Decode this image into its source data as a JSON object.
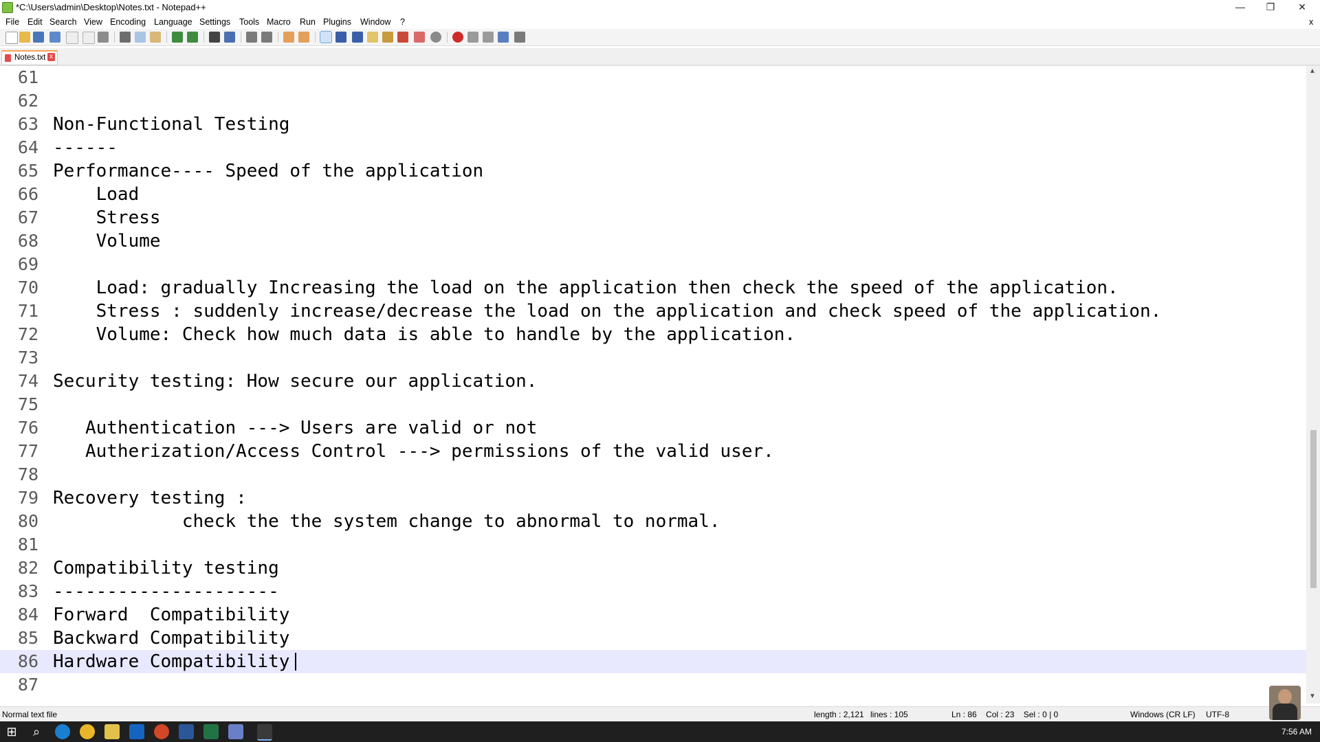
{
  "window": {
    "title": "*C:\\Users\\admin\\Desktop\\Notes.txt - Notepad++",
    "minimize_glyph": "—",
    "maximize_glyph": "❐",
    "close_glyph": "✕",
    "secondary_close_glyph": "x"
  },
  "menu": {
    "items": [
      "File",
      "Edit",
      "Search",
      "View",
      "Encoding",
      "Language",
      "Settings",
      "Tools",
      "Macro",
      "Run",
      "Plugins",
      "Window",
      "?"
    ]
  },
  "tab": {
    "label": "Notes.txt",
    "close_glyph": "x"
  },
  "editor": {
    "current_line": 86,
    "lines": [
      {
        "num": "61",
        "text": ""
      },
      {
        "num": "62",
        "text": ""
      },
      {
        "num": "63",
        "text": "Non-Functional Testing"
      },
      {
        "num": "64",
        "text": "------"
      },
      {
        "num": "65",
        "text": "Performance---- Speed of the application"
      },
      {
        "num": "66",
        "text": "    Load"
      },
      {
        "num": "67",
        "text": "    Stress"
      },
      {
        "num": "68",
        "text": "    Volume"
      },
      {
        "num": "69",
        "text": ""
      },
      {
        "num": "70",
        "text": "    Load: gradually Increasing the load on the application then check the speed of the application."
      },
      {
        "num": "71",
        "text": "    Stress : suddenly increase/decrease the load on the application and check speed of the application."
      },
      {
        "num": "72",
        "text": "    Volume: Check how much data is able to handle by the application."
      },
      {
        "num": "73",
        "text": ""
      },
      {
        "num": "74",
        "text": "Security testing: How secure our application."
      },
      {
        "num": "75",
        "text": ""
      },
      {
        "num": "76",
        "text": "   Authentication ---> Users are valid or not"
      },
      {
        "num": "77",
        "text": "   Autherization/Access Control ---> permissions of the valid user."
      },
      {
        "num": "78",
        "text": ""
      },
      {
        "num": "79",
        "text": "Recovery testing :"
      },
      {
        "num": "80",
        "text": "            check the the system change to abnormal to normal."
      },
      {
        "num": "81",
        "text": ""
      },
      {
        "num": "82",
        "text": "Compatibility testing"
      },
      {
        "num": "83",
        "text": "---------------------"
      },
      {
        "num": "84",
        "text": "Forward  Compatibility"
      },
      {
        "num": "85",
        "text": "Backward Compatibility"
      },
      {
        "num": "86",
        "text": "Hardware Compatibility"
      },
      {
        "num": "87",
        "text": ""
      }
    ]
  },
  "status": {
    "file_type": "Normal text file",
    "length": "length : 2,121",
    "lines": "lines : 105",
    "position": "Ln : 86    Col : 23    Sel : 0 | 0",
    "eol": "Windows (CR LF)",
    "encoding": "UTF-8"
  },
  "taskbar": {
    "clock": "7:56 AM",
    "search_glyph": "⌕",
    "start_glyph": "⊞"
  },
  "colors": {
    "current_line_bg": "#e8e8ff",
    "tab_accent": "#f5a05a",
    "taskbar_bg": "#1f1f1f"
  }
}
